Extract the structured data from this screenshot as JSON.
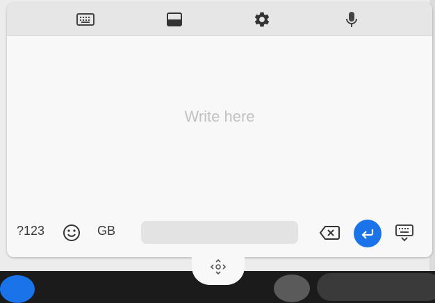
{
  "write_area": {
    "placeholder": "Write here"
  },
  "toolbar": {
    "buttons": [
      "keyboard-icon",
      "floating-mode-icon",
      "settings-icon",
      "microphone-icon"
    ]
  },
  "bottom_row": {
    "symbols_label": "?123",
    "language_label": "GB"
  },
  "colors": {
    "accent": "#1a73e8",
    "panel": "#f8f8f8",
    "toolbar": "#e6e6e6"
  }
}
